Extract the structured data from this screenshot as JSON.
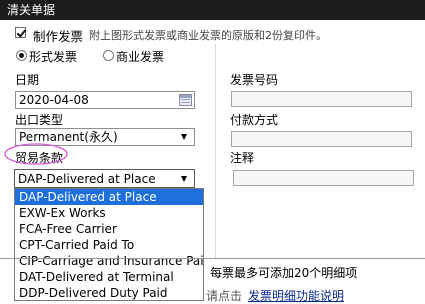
{
  "header": {
    "title": "清关单据"
  },
  "invoice": {
    "checkbox_label": "制作发票",
    "note": "附上图形式发票或商业发票的原版和2份复印件。",
    "type_options": [
      "形式发票",
      "商业发票"
    ],
    "type_selected": "形式发票"
  },
  "left": {
    "date_label": "日期",
    "date_value": "2020-04-08",
    "export_type_label": "出口类型",
    "export_type_value": "Permanent(永久)",
    "trade_terms_label": "贸易条款",
    "trade_terms_value": "DAP-Delivered at Place"
  },
  "right": {
    "invoice_no_label": "发票号码",
    "payment_label": "付款方式",
    "remark_label": "注释"
  },
  "dropdown": {
    "options": [
      "DAP-Delivered at Place",
      "EXW-Ex Works",
      "FCA-Free Carrier",
      "CPT-Carried Paid To",
      "CIP-Carriage and Insurance Paid",
      "DAT-Delivered at Terminal",
      "DDP-Delivered Duty Paid"
    ],
    "selected_index": 0
  },
  "footer": {
    "max_items": "每票最多可添加20个明细项",
    "help_prefix": "请点击",
    "help_link": "发票明细功能说明"
  },
  "colors": {
    "header_bg": "#1c1c1c",
    "selected_option_bg": "#1e6fd9",
    "highlight_ring": "#d45ad8",
    "link": "#0b2b8f"
  }
}
